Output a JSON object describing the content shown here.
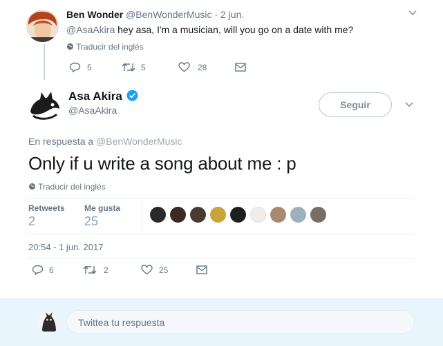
{
  "parent": {
    "name": "Ben Wonder",
    "handle": "@BenWonderMusic",
    "sep": "·",
    "date": "2 jun.",
    "mention": "@AsaAkira",
    "text": "hey asa, I'm a musician, will you go on a date with me?",
    "translate": "Traducir del inglés",
    "replies": "5",
    "retweets": "5",
    "likes": "28"
  },
  "tweet": {
    "name": "Asa Akira",
    "handle": "@AsaAkira",
    "follow_label": "Seguir",
    "in_reply_prefix": "En respuesta a",
    "in_reply_to": "@BenWonderMusic",
    "text": "Only if u write a song about me : p",
    "translate": "Traducir del inglés",
    "stats": {
      "retweets_label": "Retweets",
      "retweets": "2",
      "likes_label": "Me gusta",
      "likes": "25"
    },
    "timestamp": "20:54 - 1 jun. 2017",
    "actions": {
      "replies": "6",
      "retweets": "2",
      "likes": "25"
    }
  },
  "reply": {
    "placeholder": "Twittea tu respuesta"
  },
  "colors": {
    "link": "#657786",
    "verified": "#1da1f2",
    "border": "#e6ecf0"
  },
  "icons": [
    "chevron-down-icon",
    "globe-icon",
    "reply-icon",
    "retweet-icon",
    "heart-icon",
    "message-icon",
    "verified-icon"
  ]
}
